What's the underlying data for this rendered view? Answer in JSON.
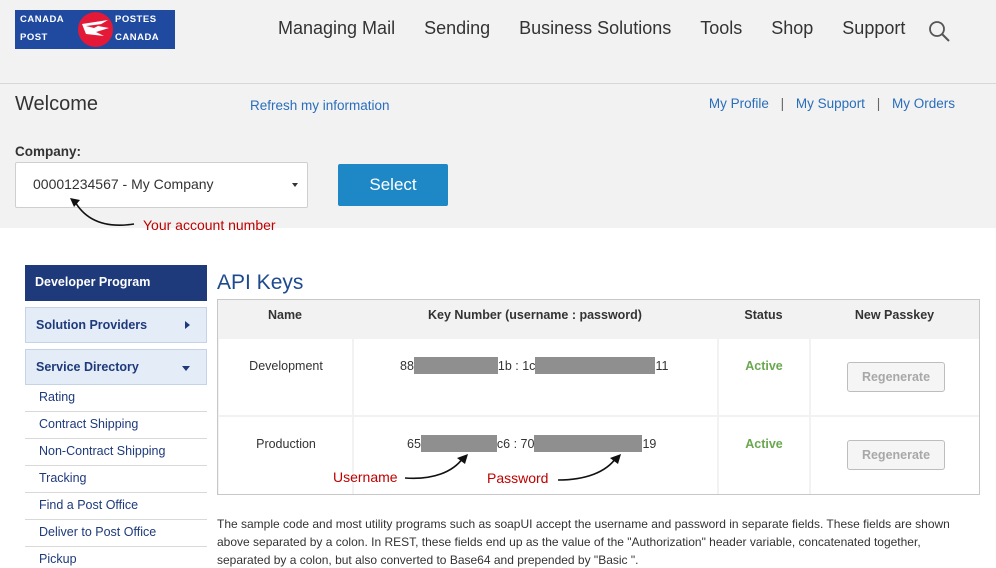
{
  "logo": {
    "canada_en": "CANADA",
    "post": "POST",
    "postes": "POSTES",
    "canada_fr": "CANADA"
  },
  "nav": {
    "items": [
      "Managing Mail",
      "Sending",
      "Business Solutions",
      "Tools",
      "Shop",
      "Support"
    ]
  },
  "welcome": {
    "title": "Welcome",
    "refresh_label": "Refresh my information",
    "links": [
      "My Profile",
      "My Support",
      "My Orders"
    ],
    "separator": "|"
  },
  "company": {
    "label": "Company:",
    "selected_value": "00001234567 - My Company",
    "select_button": "Select",
    "annotation": "Your account number"
  },
  "sidebar": {
    "heading": "Developer Program",
    "sections": [
      "Solution Providers",
      "Service Directory"
    ],
    "items": [
      "Rating",
      "Contract Shipping",
      "Non-Contract Shipping",
      "Tracking",
      "Find a Post Office",
      "Deliver to Post Office",
      "Pickup"
    ]
  },
  "api_keys": {
    "title": "API Keys",
    "columns": [
      "Name",
      "Key Number (username : password)",
      "Status",
      "New Passkey"
    ],
    "rows": [
      {
        "name": "Development",
        "key_prefix": "88",
        "key_mid_a": "1b : 1c",
        "key_mid_b": "",
        "key_suffix": "11",
        "status": "Active",
        "action": "Regenerate"
      },
      {
        "name": "Production",
        "key_prefix": "65",
        "key_mid_a": "c6 : 70",
        "key_mid_b": "",
        "key_suffix": "19",
        "status": "Active",
        "action": "Regenerate"
      }
    ],
    "annotation_username": "Username",
    "annotation_password": "Password"
  },
  "description": "The sample code and most utility programs such as soapUI accept the username and password in separate fields. These fields are shown above separated by a colon. In REST, these fields end up as the value of the \"Authorization\" header variable, concatenated together, separated by a colon, but also converted to Base64 and prepended by \"Basic \".",
  "colors": {
    "brand_blue": "#1f4aa0",
    "brand_red": "#e31937",
    "link_blue": "#2a6ebb",
    "button_blue": "#1e88c7",
    "active_green": "#6aa84f",
    "annotation_red": "#c00000"
  }
}
